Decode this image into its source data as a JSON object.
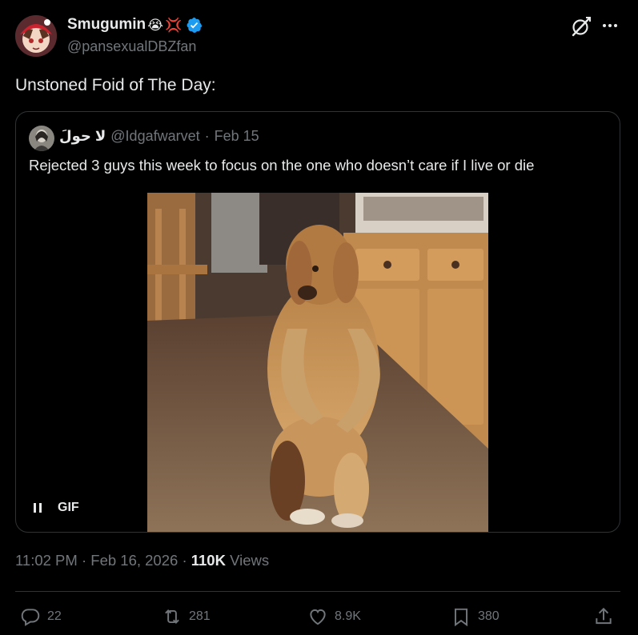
{
  "author": {
    "display_name": "Smugumin",
    "name_emojis": [
      "😭",
      "💢"
    ],
    "handle": "@pansexualDBZfan",
    "verified": true
  },
  "tweet": {
    "text": "Unstoned Foid of The Day:"
  },
  "quote": {
    "display_name": "لا حولَ",
    "handle": "@Idgafwarvet",
    "separator": "·",
    "date": "Feb 15",
    "text": "Rejected 3 guys this week to focus on the one who doesn’t care if I live or die",
    "media_label": "GIF"
  },
  "meta": {
    "time": "11:02 PM",
    "sep1": "·",
    "date": "Feb 16, 2026",
    "sep2": "·",
    "views_count": "110K",
    "views_label": "Views"
  },
  "actions": {
    "replies": "22",
    "reposts": "281",
    "likes": "8.9K",
    "bookmarks": "380"
  },
  "colors": {
    "background": "#000000",
    "text_primary": "#e7e9ea",
    "text_secondary": "#71767b",
    "border": "#2f3336",
    "verified_blue": "#1d9bf0"
  },
  "icons": [
    "grok-icon",
    "more-icon",
    "verified-badge-icon",
    "pause-icon",
    "reply-icon",
    "repost-icon",
    "like-icon",
    "bookmark-icon",
    "share-icon"
  ]
}
